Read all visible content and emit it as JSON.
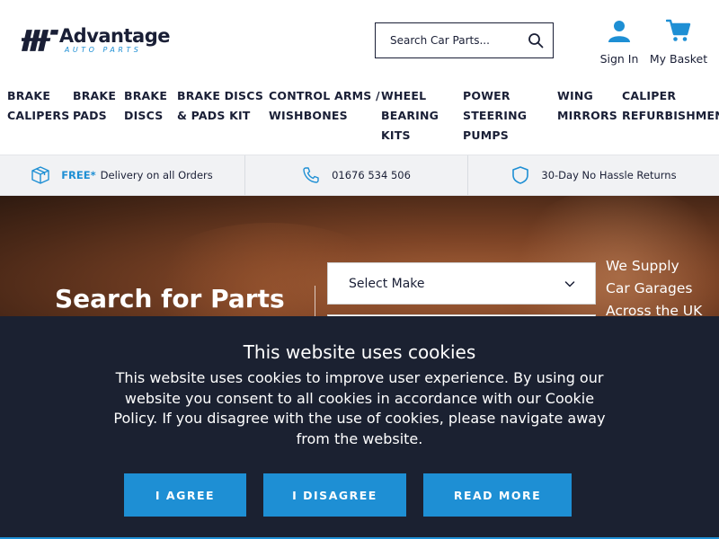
{
  "brand": {
    "name": "Advantage",
    "tagline": "AUTO PARTS",
    "accent": "#1e8fd4",
    "dark": "#1a1f36"
  },
  "header": {
    "search_placeholder": "Search Car Parts...",
    "sign_in": "Sign In",
    "basket": "My Basket"
  },
  "nav": [
    {
      "lines": [
        "BRAKE",
        "CALIPERS"
      ]
    },
    {
      "lines": [
        "BRAKE",
        "PADS"
      ]
    },
    {
      "lines": [
        "BRAKE",
        "DISCS"
      ]
    },
    {
      "lines": [
        "BRAKE DISCS",
        "& PADS KIT"
      ]
    },
    {
      "lines": [
        "CONTROL ARMS /",
        "WISHBONES"
      ]
    },
    {
      "lines": [
        "WHEEL",
        "BEARING",
        "KITS"
      ]
    },
    {
      "lines": [
        "POWER",
        "STEERING",
        "PUMPS"
      ]
    },
    {
      "lines": [
        "WING",
        "MIRRORS"
      ]
    },
    {
      "lines": [
        "CALIPER",
        "REFURBISHMENT"
      ]
    }
  ],
  "usp": {
    "delivery_free": "FREE*",
    "delivery_text": "Delivery on all Orders",
    "phone": "01676 534 506",
    "returns": "30-Day No Hassle Returns"
  },
  "hero": {
    "title": "Search for Parts",
    "select_make": "Select Make",
    "supply_lines": [
      "We Supply",
      "Car Garages",
      "Across the UK"
    ]
  },
  "cookie": {
    "title": "This website uses cookies",
    "text": "This website uses cookies to improve user experience. By using our website you consent to all cookies in accordance with our Cookie Policy. If you disagree with the use of cookies, please navigate away from the website.",
    "agree": "I AGREE",
    "disagree": "I DISAGREE",
    "read_more": "READ MORE"
  }
}
